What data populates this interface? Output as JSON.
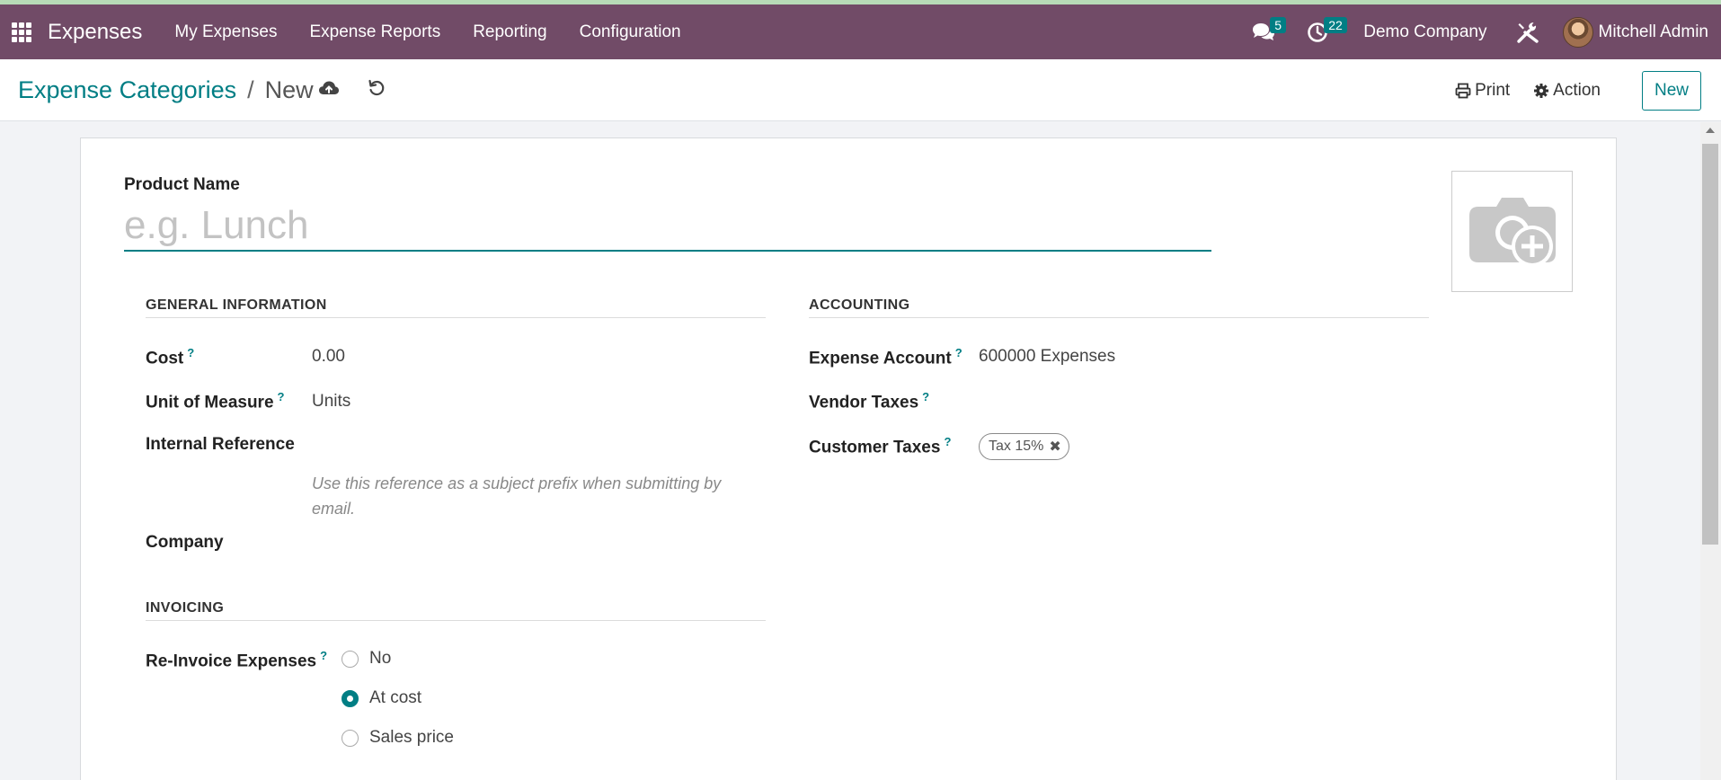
{
  "navbar": {
    "app_title": "Expenses",
    "menu": [
      "My Expenses",
      "Expense Reports",
      "Reporting",
      "Configuration"
    ],
    "messages_count": "5",
    "activities_count": "22",
    "company": "Demo Company",
    "user": "Mitchell Admin",
    "colors": {
      "bar": "#714b67",
      "accent": "#017e84"
    }
  },
  "control_panel": {
    "breadcrumb_parent": "Expense Categories",
    "breadcrumb_separator": "/",
    "breadcrumb_current": "New",
    "print_label": "Print",
    "action_label": "Action",
    "new_label": "New"
  },
  "form": {
    "product_name_label": "Product Name",
    "product_name_placeholder": "e.g. Lunch",
    "product_name_value": "",
    "general_section": "GENERAL INFORMATION",
    "cost_label": "Cost",
    "cost_value": "0.00",
    "uom_label": "Unit of Measure",
    "uom_value": "Units",
    "internal_ref_label": "Internal Reference",
    "internal_ref_hint": "Use this reference as a subject prefix when submitting by email.",
    "company_label": "Company",
    "accounting_section": "ACCOUNTING",
    "expense_account_label": "Expense Account",
    "expense_account_value": "600000 Expenses",
    "vendor_taxes_label": "Vendor Taxes",
    "customer_taxes_label": "Customer Taxes",
    "customer_tax_tag": "Tax 15%",
    "invoicing_section": "INVOICING",
    "reinvoice_label": "Re-Invoice Expenses",
    "reinvoice_options": [
      "No",
      "At cost",
      "Sales price"
    ],
    "reinvoice_selected": "At cost",
    "help_mark": "?"
  }
}
